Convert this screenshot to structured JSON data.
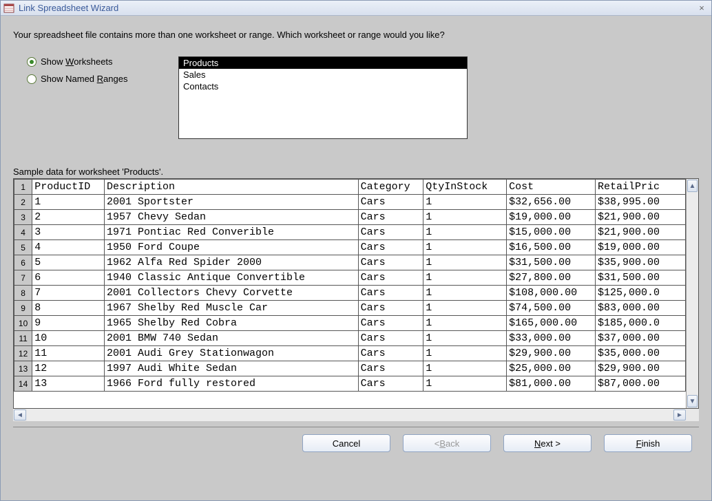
{
  "window": {
    "title": "Link Spreadsheet Wizard"
  },
  "instruction": "Your spreadsheet file contains more than one worksheet or range. Which worksheet or range would you like?",
  "radios": {
    "worksheets_prefix": "Show ",
    "worksheets_u": "W",
    "worksheets_suffix": "orksheets",
    "ranges_prefix": "Show Named ",
    "ranges_u": "R",
    "ranges_suffix": "anges",
    "selected": "worksheets"
  },
  "listbox": {
    "items": [
      "Products",
      "Sales",
      "Contacts"
    ],
    "selected_index": 0
  },
  "sample_label": "Sample data for worksheet 'Products'.",
  "columns": [
    "ProductID",
    "Description",
    "Category",
    "QtyInStock",
    "Cost",
    "RetailPric"
  ],
  "col_widths": [
    "104px",
    "366px",
    "94px",
    "120px",
    "128px",
    "130px"
  ],
  "rows": [
    [
      "1",
      "2001 Sportster",
      "Cars",
      "1",
      "$32,656.00",
      "$38,995.00"
    ],
    [
      "2",
      "1957 Chevy Sedan",
      "Cars",
      "1",
      "$19,000.00",
      "$21,900.00"
    ],
    [
      "3",
      "1971 Pontiac Red Converible",
      "Cars",
      "1",
      "$15,000.00",
      "$21,900.00"
    ],
    [
      "4",
      "1950 Ford Coupe",
      "Cars",
      "1",
      "$16,500.00",
      "$19,000.00"
    ],
    [
      "5",
      "1962 Alfa Red Spider 2000",
      "Cars",
      "1",
      "$31,500.00",
      "$35,900.00"
    ],
    [
      "6",
      "1940 Classic Antique Convertible",
      "Cars",
      "1",
      "$27,800.00",
      "$31,500.00"
    ],
    [
      "7",
      "2001 Collectors Chevy Corvette",
      "Cars",
      "1",
      "$108,000.00",
      "$125,000.0"
    ],
    [
      "8",
      "1967 Shelby Red Muscle Car",
      "Cars",
      "1",
      "$74,500.00",
      "$83,000.00"
    ],
    [
      "9",
      "1965 Shelby Red Cobra",
      "Cars",
      "1",
      "$165,000.00",
      "$185,000.0"
    ],
    [
      "10",
      "2001 BMW 740 Sedan",
      "Cars",
      "1",
      "$33,000.00",
      "$37,000.00"
    ],
    [
      "11",
      "2001 Audi Grey Stationwagon",
      "Cars",
      "1",
      "$29,900.00",
      "$35,000.00"
    ],
    [
      "12",
      "1997 Audi White Sedan",
      "Cars",
      "1",
      "$25,000.00",
      "$29,900.00"
    ],
    [
      "13",
      "1966 Ford fully restored",
      "Cars",
      "1",
      "$81,000.00",
      "$87,000.00"
    ]
  ],
  "buttons": {
    "cancel": "Cancel",
    "back_prefix": "< ",
    "back_u": "B",
    "back_suffix": "ack",
    "next_u": "N",
    "next_suffix": "ext >",
    "finish_u": "F",
    "finish_suffix": "inish"
  }
}
